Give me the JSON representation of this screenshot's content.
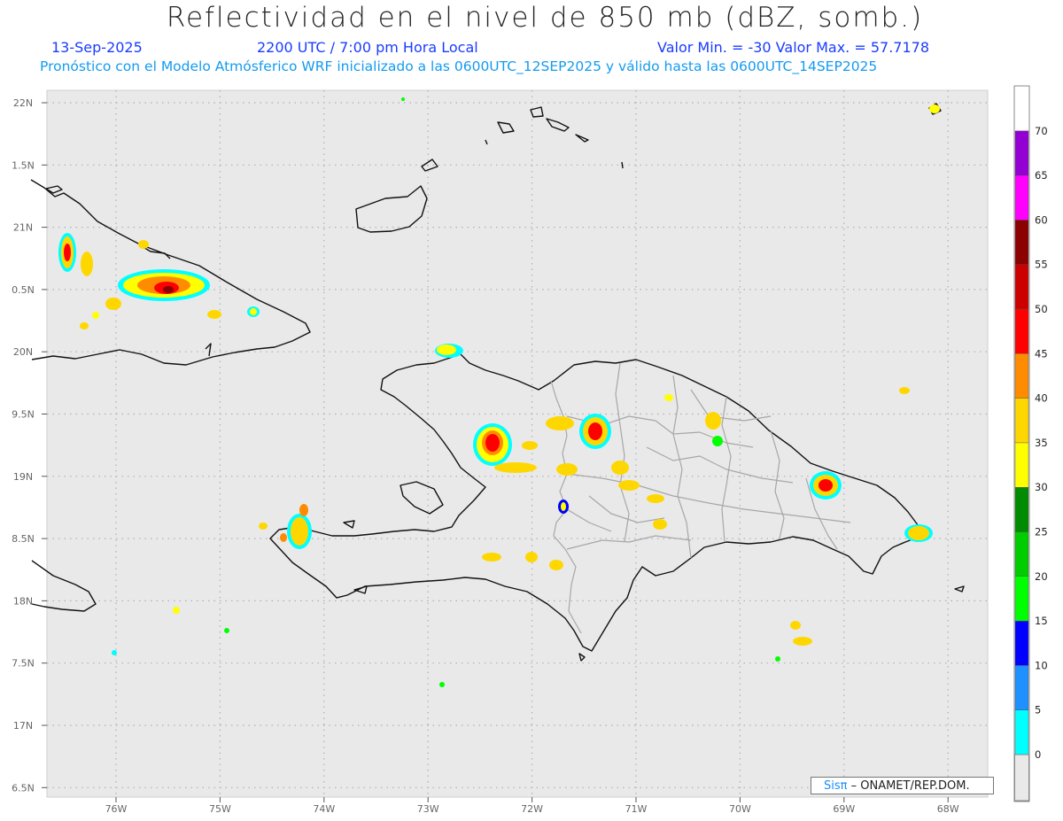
{
  "header": {
    "title": "Reflectividad en el nivel de 850 mb (dBZ, somb.)",
    "date": "13-Sep-2025",
    "time": "2200 UTC / 7:00 pm Hora Local",
    "minmax": "Valor Min. = -30  Valor Max. = 57.7178",
    "forecast_note": "Pronóstico con el Modelo Atmósferico WRF inicializado a las 0600UTC_12SEP2025 y válido hasta las  0600UTC_14SEP2025"
  },
  "axes": {
    "lat_labels": [
      "22N",
      "1.5N",
      "21N",
      "0.5N",
      "20N",
      "9.5N",
      "19N",
      "8.5N",
      "18N",
      "7.5N",
      "17N",
      "6.5N"
    ],
    "lon_labels": [
      "76W",
      "75W",
      "74W",
      "73W",
      "72W",
      "71W",
      "70W",
      "69W",
      "68W"
    ]
  },
  "colorbar": {
    "labels": [
      "0",
      "5",
      "10",
      "15",
      "20",
      "25",
      "30",
      "35",
      "40",
      "45",
      "50",
      "55",
      "60",
      "65",
      "70"
    ],
    "colors": [
      "#00ffff",
      "#1e90ff",
      "#0000ff",
      "#00ff00",
      "#00cd00",
      "#008b00",
      "#ffff00",
      "#ffd700",
      "#ff8c00",
      "#ff0000",
      "#cd0000",
      "#8b0000",
      "#ff00ff",
      "#9400d3"
    ]
  },
  "credit": {
    "sis": "Sisπ",
    "rest": "– ONAMET/REP.DOM."
  }
}
